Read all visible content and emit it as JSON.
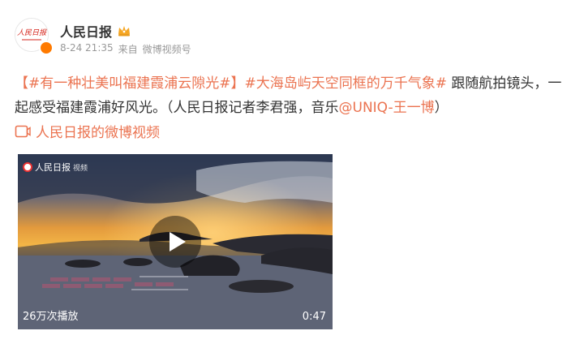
{
  "author": {
    "name": "人民日报",
    "avatar_text": "人民日报",
    "badge_icon": "crown-icon",
    "verified_icon": "verified-v-icon"
  },
  "meta": {
    "time": "8-24 21:35",
    "source_prefix": "来自",
    "source": "微博视频号"
  },
  "post": {
    "topic1": "【#有一种壮美叫福建霞浦云隙光#】",
    "topic2": "#大海岛屿天空同框的万千气象#",
    "text1": " 跟随航拍镜头，一起感受福建霞浦好风光。（人民日报记者李君强，音乐",
    "mention": "@UNIQ-王一博",
    "text2": "）"
  },
  "video_link": {
    "icon": "video-icon",
    "label": "人民日报的微博视频"
  },
  "video": {
    "watermark_main": "人民日报",
    "watermark_sub": "视频",
    "plays": "26万次播放",
    "duration": "0:47",
    "play_icon": "play-icon"
  },
  "colors": {
    "link": "#eb7350",
    "text": "#333333",
    "meta": "#999999"
  }
}
